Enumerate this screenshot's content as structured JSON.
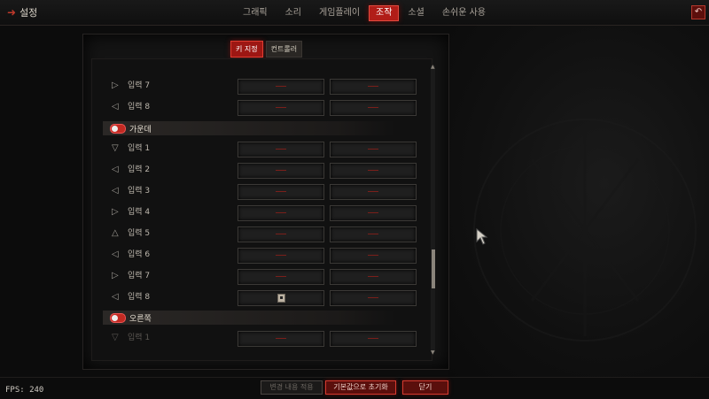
{
  "header": {
    "title": "설정",
    "tabs": [
      "그래픽",
      "소리",
      "게임플레이",
      "조작",
      "소셜",
      "손쉬운 사용"
    ],
    "active_tab": "조작"
  },
  "controller_tabs": {
    "items": [
      "키 지정",
      "컨트롤러"
    ],
    "active": "키 지정"
  },
  "list": {
    "rows_top": [
      {
        "label": "입력 7",
        "icon": "arrow-right-outline-icon"
      },
      {
        "label": "입력 8",
        "icon": "arrow-up-left-outline-icon"
      }
    ],
    "section_middle": {
      "label": "가운데"
    },
    "rows_middle": [
      {
        "label": "입력 1",
        "icon": "arrow-down-outline-icon"
      },
      {
        "label": "입력 2",
        "icon": "arrow-down-left-outline-icon"
      },
      {
        "label": "입력 3",
        "icon": "arrow-left-outline-icon"
      },
      {
        "label": "입력 4",
        "icon": "arrow-up-right-outline-icon"
      },
      {
        "label": "입력 5",
        "icon": "arrow-up-outline-icon"
      },
      {
        "label": "입력 6",
        "icon": "arrow-up-right-outline-icon"
      },
      {
        "label": "입력 7",
        "icon": "arrow-right-outline-icon"
      },
      {
        "label": "입력 8",
        "icon": "arrow-up-left-outline-icon"
      }
    ],
    "section_right": {
      "label": "오른쪽"
    },
    "rows_right": [
      {
        "label": "입력 1",
        "icon": "arrow-down-outline-icon"
      }
    ],
    "slot_placeholder": "—"
  },
  "footer": {
    "fps": "FPS: 240",
    "apply": "변경 내용 적용",
    "reset": "기본값으로 초기화",
    "close": "닫기"
  }
}
